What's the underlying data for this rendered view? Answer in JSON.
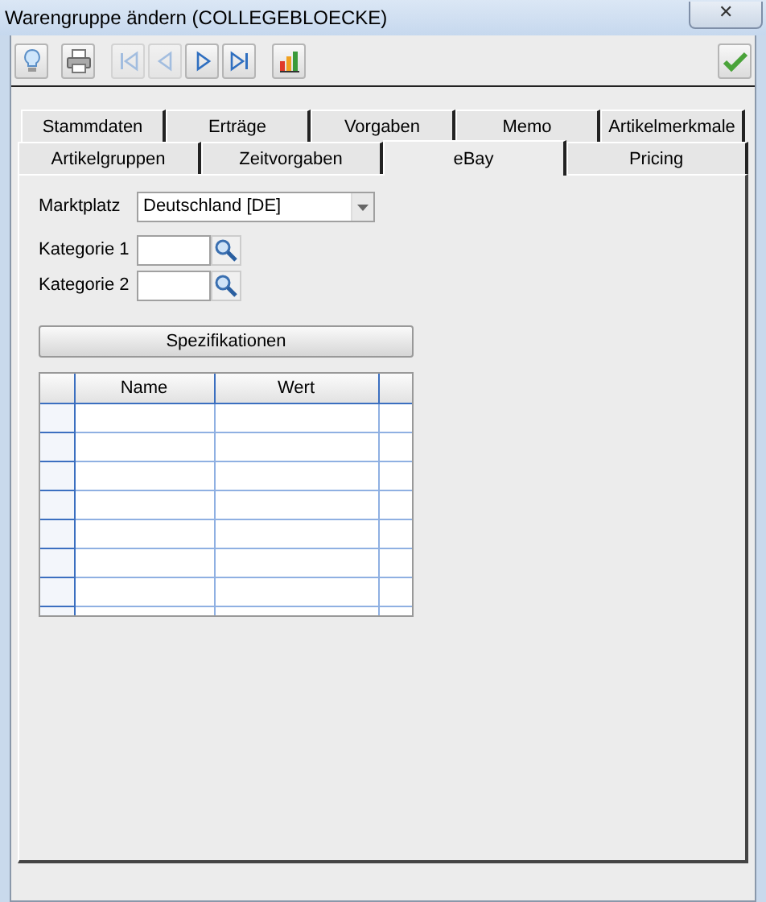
{
  "window": {
    "title": "Warengruppe ändern (COLLEGEBLOECKE)",
    "close": "✕"
  },
  "toolbar": [
    {
      "kind": "bulb",
      "disabled": false
    },
    {
      "kind": "printer",
      "disabled": false
    },
    {
      "kind": "first",
      "disabled": true
    },
    {
      "kind": "prev",
      "disabled": true
    },
    {
      "kind": "next",
      "disabled": false
    },
    {
      "kind": "last",
      "disabled": false
    },
    {
      "kind": "chart",
      "disabled": false
    },
    {
      "kind": "ok",
      "disabled": false
    }
  ],
  "tabs": [
    [
      {
        "label": "Stammdaten",
        "selected": false
      },
      {
        "label": "Erträge",
        "selected": false
      },
      {
        "label": "Vorgaben",
        "selected": false
      },
      {
        "label": "Memo",
        "selected": false
      },
      {
        "label": "Artikelmerkmale",
        "selected": false
      }
    ],
    [
      {
        "label": "Artikelgruppen",
        "selected": false
      },
      {
        "label": "Zeitvorgaben",
        "selected": false
      },
      {
        "label": "eBay",
        "selected": true
      },
      {
        "label": "Pricing",
        "selected": false
      }
    ]
  ],
  "form": {
    "marktplatz": {
      "label": "Marktplatz",
      "value": "Deutschland [DE]"
    },
    "kategorien": [
      {
        "label": "Kategorie 1"
      },
      {
        "label": "Kategorie 2"
      }
    ],
    "button": "Spezifikationen"
  },
  "table": {
    "columns": [
      "Name",
      "Wert"
    ]
  }
}
